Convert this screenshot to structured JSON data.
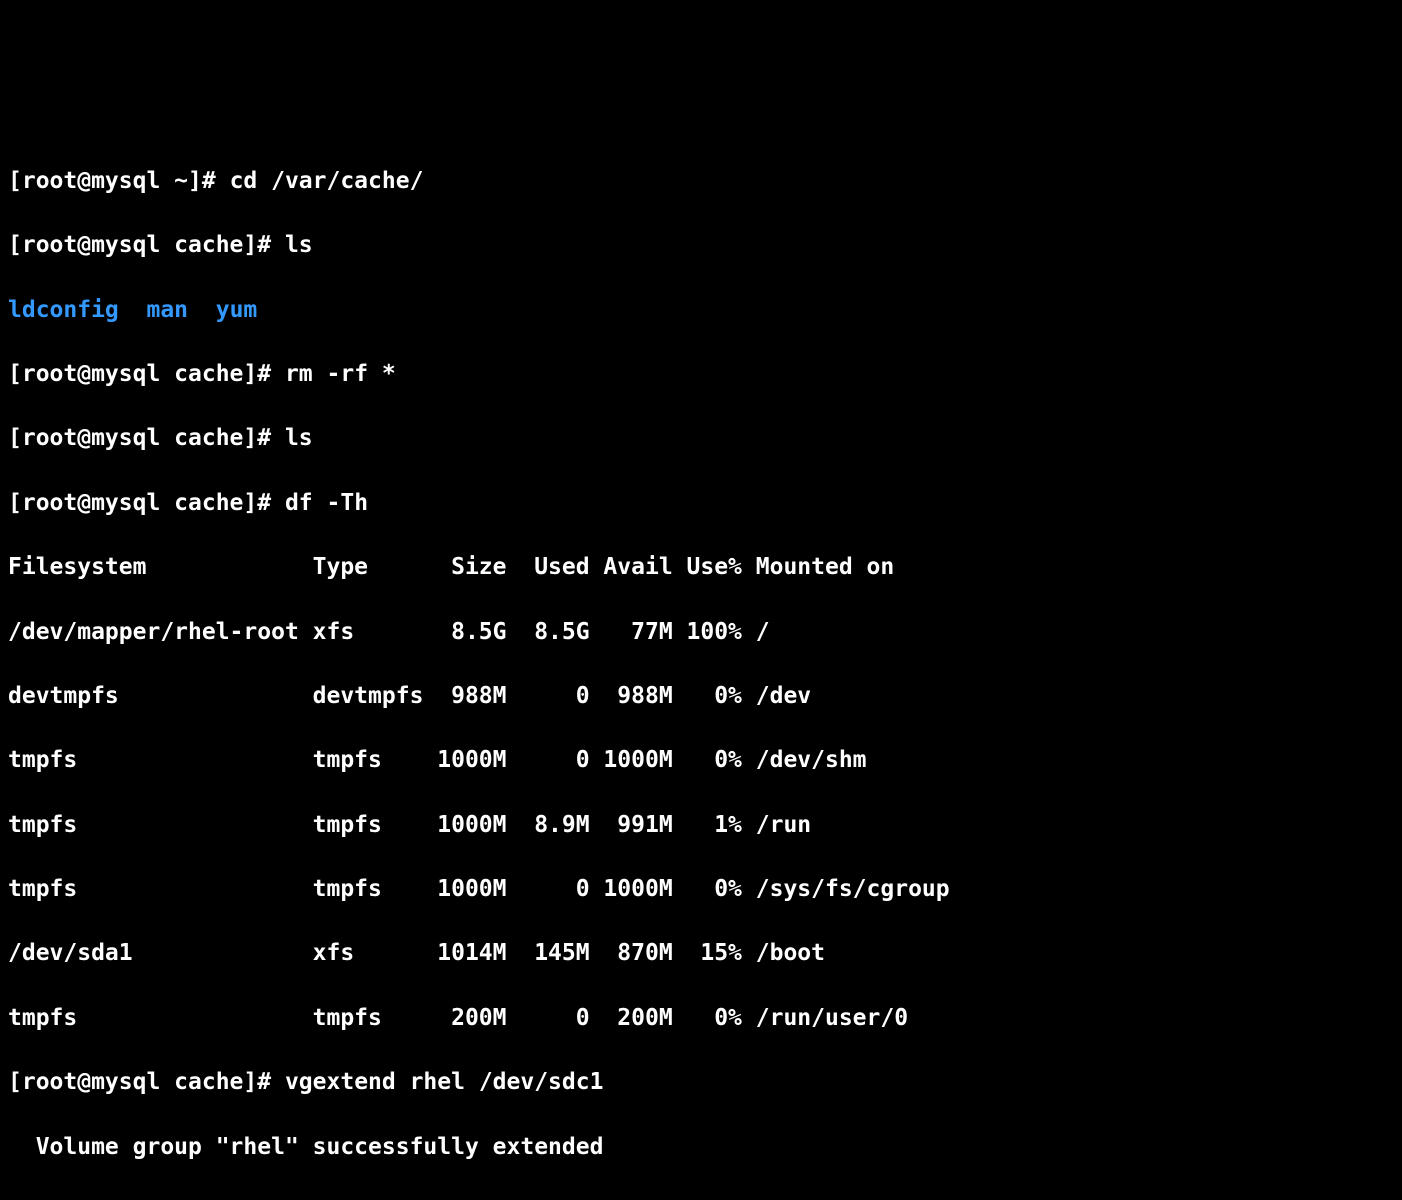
{
  "prompts": {
    "p1_prompt": "[root@mysql ~]# ",
    "p1_cmd": "cd /var/cache/",
    "p2_prompt": "[root@mysql cache]# ",
    "p2_cmd": "ls",
    "ls_output": {
      "item1": "ldconfig",
      "sep1": "  ",
      "item2": "man",
      "sep2": "  ",
      "item3": "yum"
    },
    "p3_prompt": "[root@mysql cache]# ",
    "p3_cmd": "rm -rf *",
    "p4_prompt": "[root@mysql cache]# ",
    "p4_cmd": "ls",
    "p5_prompt": "[root@mysql cache]# ",
    "p5_cmd": "df -Th",
    "p6_prompt": "[root@mysql cache]# ",
    "p6_cmd": "vgextend rhel /dev/sdc1",
    "vg_output": "  Volume group \"rhel\" successfully extended"
  },
  "df": {
    "header": "Filesystem            Type      Size  Used Avail Use% Mounted on",
    "rows": [
      "/dev/mapper/rhel-root xfs       8.5G  8.5G   77M 100% /",
      "devtmpfs              devtmpfs  988M     0  988M   0% /dev",
      "tmpfs                 tmpfs    1000M     0 1000M   0% /dev/shm",
      "tmpfs                 tmpfs    1000M  8.9M  991M   1% /run",
      "tmpfs                 tmpfs    1000M     0 1000M   0% /sys/fs/cgroup",
      "/dev/sda1             xfs      1014M  145M  870M  15% /boot",
      "tmpfs                 tmpfs     200M     0  200M   0% /run/user/0"
    ]
  }
}
